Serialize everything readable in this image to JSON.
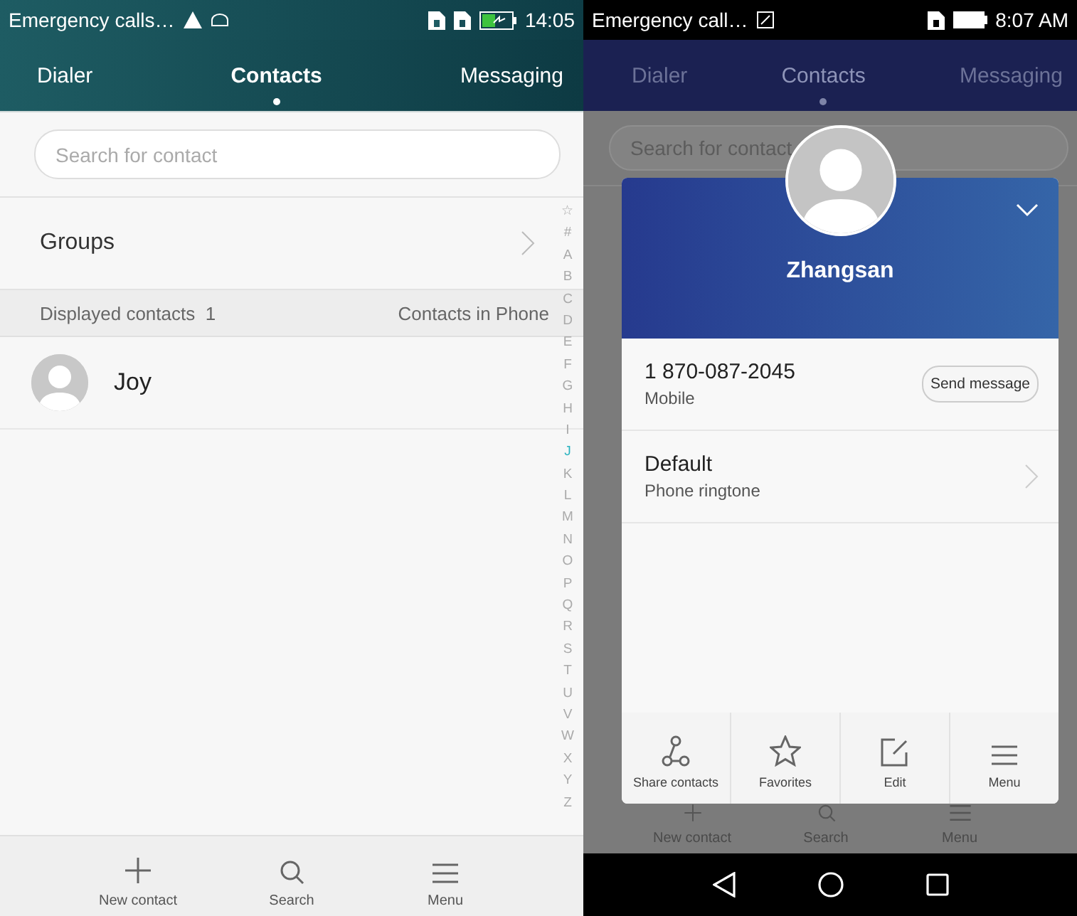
{
  "left_screen": {
    "status_bar": {
      "notification": "Emergency calls…",
      "time": "14:05"
    },
    "tabs": [
      {
        "label": "Dialer",
        "selected": false
      },
      {
        "label": "Contacts",
        "selected": true
      },
      {
        "label": "Messaging",
        "selected": false
      }
    ],
    "search": {
      "placeholder": "Search for contact"
    },
    "groups": {
      "label": "Groups"
    },
    "section_header": {
      "count_label": "Displayed contacts",
      "count": "1",
      "source": "Contacts in Phone"
    },
    "contacts": [
      {
        "name": "Joy"
      }
    ],
    "index": [
      {
        "letter": "☆",
        "selected": false
      },
      {
        "letter": "#",
        "selected": false
      },
      {
        "letter": "A",
        "selected": false
      },
      {
        "letter": "B",
        "selected": false
      },
      {
        "letter": "C",
        "selected": false
      },
      {
        "letter": "D",
        "selected": false
      },
      {
        "letter": "E",
        "selected": false
      },
      {
        "letter": "F",
        "selected": false
      },
      {
        "letter": "G",
        "selected": false
      },
      {
        "letter": "H",
        "selected": false
      },
      {
        "letter": "I",
        "selected": false
      },
      {
        "letter": "J",
        "selected": true
      },
      {
        "letter": "K",
        "selected": false
      },
      {
        "letter": "L",
        "selected": false
      },
      {
        "letter": "M",
        "selected": false
      },
      {
        "letter": "N",
        "selected": false
      },
      {
        "letter": "O",
        "selected": false
      },
      {
        "letter": "P",
        "selected": false
      },
      {
        "letter": "Q",
        "selected": false
      },
      {
        "letter": "R",
        "selected": false
      },
      {
        "letter": "S",
        "selected": false
      },
      {
        "letter": "T",
        "selected": false
      },
      {
        "letter": "U",
        "selected": false
      },
      {
        "letter": "V",
        "selected": false
      },
      {
        "letter": "W",
        "selected": false
      },
      {
        "letter": "X",
        "selected": false
      },
      {
        "letter": "Y",
        "selected": false
      },
      {
        "letter": "Z",
        "selected": false
      }
    ],
    "bottom_bar": [
      {
        "label": "New contact",
        "kind": "add"
      },
      {
        "label": "Search",
        "kind": "search"
      },
      {
        "label": "Menu",
        "kind": "menu"
      }
    ]
  },
  "right_screen": {
    "status_bar": {
      "notification": "Emergency call…",
      "time": "8:07 AM"
    },
    "tabs": [
      {
        "label": "Dialer",
        "selected": false
      },
      {
        "label": "Contacts",
        "selected": true
      },
      {
        "label": "Messaging",
        "selected": false
      }
    ],
    "search": {
      "placeholder": "Search for contact"
    },
    "bottom_bar": [
      {
        "label": "New contact",
        "kind": "add"
      },
      {
        "label": "Search",
        "kind": "search"
      },
      {
        "label": "Menu",
        "kind": "menu"
      }
    ],
    "contact_card": {
      "name": "Zhangsan",
      "phone": "1 870-087-2045",
      "phone_type": "Mobile",
      "message_button": "Send message",
      "ringtone": "Default",
      "ringtone_label": "Phone ringtone",
      "actions": [
        {
          "label": "Share contacts",
          "kind": "share"
        },
        {
          "label": "Favorites",
          "kind": "star"
        },
        {
          "label": "Edit",
          "kind": "edit"
        },
        {
          "label": "Menu",
          "kind": "menu"
        }
      ]
    }
  }
}
